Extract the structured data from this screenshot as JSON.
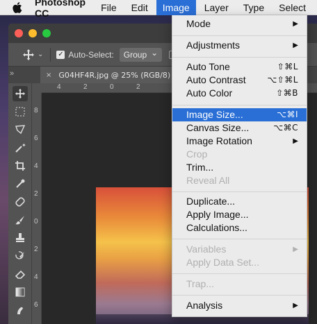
{
  "menubar": {
    "app_name": "Photoshop CC",
    "items": [
      "File",
      "Edit",
      "Image",
      "Layer",
      "Type",
      "Select"
    ],
    "active_item": "Image",
    "highlight_color": "#2a6fd6"
  },
  "options": {
    "auto_select_label": "Auto-Select:",
    "auto_select_checked": true,
    "group_value": "Group",
    "show_transform_partial": "S"
  },
  "document": {
    "tab_title": "G04HF4R.jpg @ 25% (RGB/8)",
    "close_glyph": "×",
    "collapse_glyph": "»"
  },
  "ruler": {
    "top_ticks": [
      "4",
      "2",
      "0",
      "2",
      "4",
      "6",
      "8"
    ],
    "left_ticks": [
      "8",
      "6",
      "4",
      "2",
      "0",
      "2",
      "4",
      "6",
      "8"
    ]
  },
  "tools": [
    "move-tool-icon",
    "marquee-tool-icon",
    "lasso-tool-icon",
    "magic-wand-icon",
    "crop-tool-icon",
    "eyedropper-icon",
    "healing-brush-icon",
    "brush-tool-icon",
    "clone-stamp-icon",
    "history-brush-icon",
    "eraser-icon",
    "gradient-icon",
    "smudge-icon"
  ],
  "image_menu": {
    "mode": "Mode",
    "adjustments": "Adjustments",
    "auto_tone": "Auto Tone",
    "auto_tone_sc": "⇧⌘L",
    "auto_contrast": "Auto Contrast",
    "auto_contrast_sc": "⌥⇧⌘L",
    "auto_color": "Auto Color",
    "auto_color_sc": "⇧⌘B",
    "image_size": "Image Size...",
    "image_size_sc": "⌥⌘I",
    "canvas_size": "Canvas Size...",
    "canvas_size_sc": "⌥⌘C",
    "image_rotation": "Image Rotation",
    "crop": "Crop",
    "trim": "Trim...",
    "reveal_all": "Reveal All",
    "duplicate": "Duplicate...",
    "apply_image": "Apply Image...",
    "calculations": "Calculations...",
    "variables": "Variables",
    "apply_data_set": "Apply Data Set...",
    "trap": "Trap...",
    "analysis": "Analysis",
    "submenu_arrow": "▶"
  }
}
